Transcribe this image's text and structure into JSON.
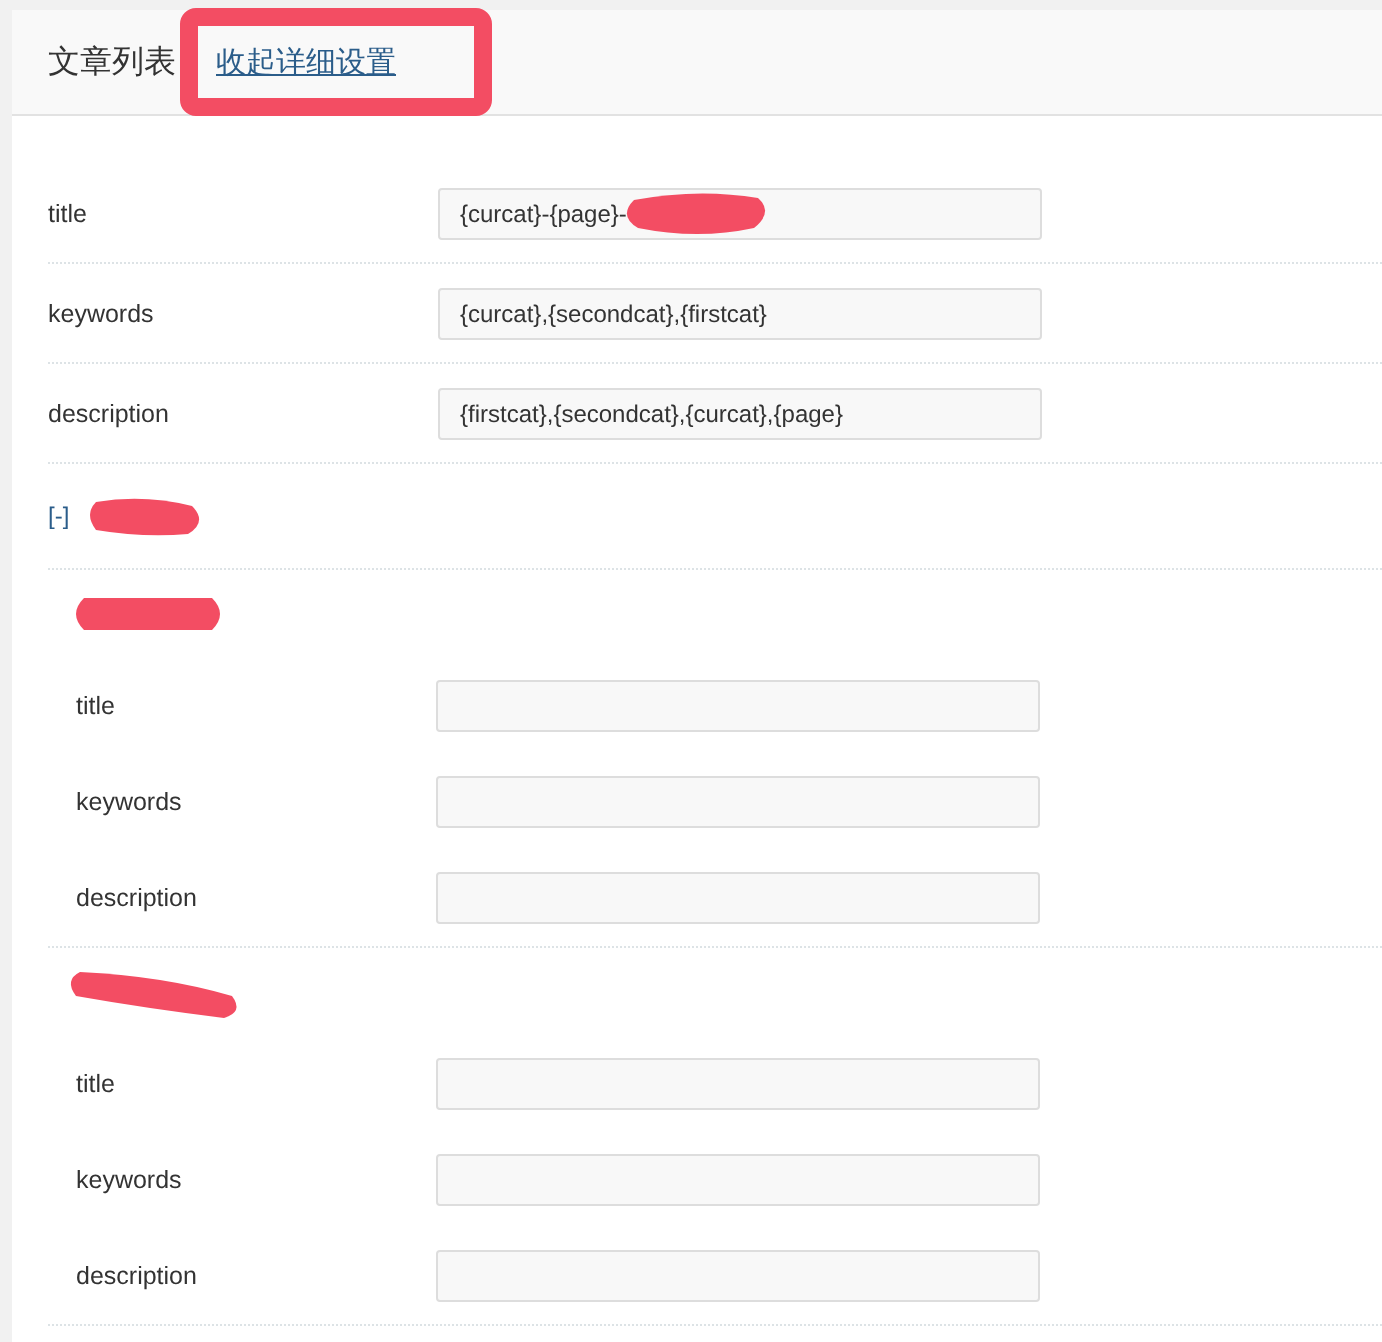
{
  "header": {
    "title": "文章列表",
    "toggle_link": "收起详细设置"
  },
  "fields": [
    {
      "label": "title",
      "value": "{curcat}-{page}-"
    },
    {
      "label": "keywords",
      "value": "{curcat},{secondcat},{firstcat}"
    },
    {
      "label": "description",
      "value": "{firstcat},{secondcat},{curcat},{page}"
    }
  ],
  "group": {
    "toggle": "[-]",
    "sections": [
      {
        "fields": [
          {
            "label": "title"
          },
          {
            "label": "keywords"
          },
          {
            "label": "description"
          }
        ]
      },
      {
        "fields": [
          {
            "label": "title"
          },
          {
            "label": "keywords"
          },
          {
            "label": "description"
          }
        ]
      }
    ]
  }
}
